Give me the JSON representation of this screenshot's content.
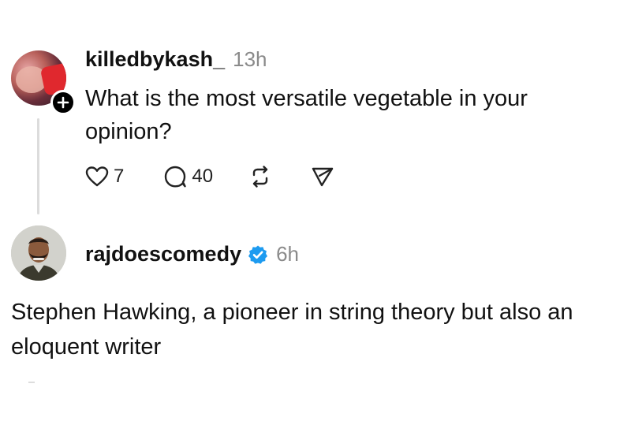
{
  "post1": {
    "username": "killedbykash_",
    "timestamp": "13h",
    "text": "What is the most versatile vegetable in your opinion?",
    "avatar_icon": "user-avatar-photo",
    "follow_icon": "plus-icon",
    "actions": {
      "like_count": "7",
      "reply_count": "40",
      "like_icon": "heart-icon",
      "reply_icon": "comment-bubble-icon",
      "repost_icon": "repost-icon",
      "share_icon": "send-icon"
    }
  },
  "post2": {
    "username": "rajdoescomedy",
    "verified": true,
    "verified_icon": "verified-badge-icon",
    "timestamp": "6h",
    "text": "Stephen Hawking, a pioneer in string theory but also an eloquent writer",
    "avatar_icon": "user-avatar-photo"
  },
  "colors": {
    "text": "#111111",
    "muted": "#8a8a8a",
    "verified": "#1d9bf0",
    "thread_line": "#dcdcdc"
  }
}
